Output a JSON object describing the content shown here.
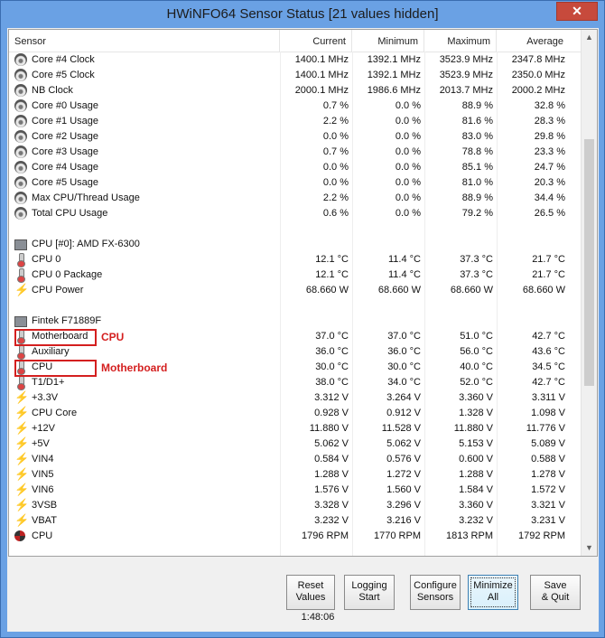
{
  "window": {
    "title": "HWiNFO64 Sensor Status [21 values hidden]",
    "close_glyph": "✕"
  },
  "header": {
    "sensor": "Sensor",
    "current": "Current",
    "minimum": "Minimum",
    "maximum": "Maximum",
    "average": "Average"
  },
  "rows": [
    {
      "icon": "gauge",
      "name": "Core #4 Clock",
      "cur": "1400.1 MHz",
      "min": "1392.1 MHz",
      "max": "3523.9 MHz",
      "avg": "2347.8 MHz"
    },
    {
      "icon": "gauge",
      "name": "Core #5 Clock",
      "cur": "1400.1 MHz",
      "min": "1392.1 MHz",
      "max": "3523.9 MHz",
      "avg": "2350.0 MHz"
    },
    {
      "icon": "gauge",
      "name": "NB Clock",
      "cur": "2000.1 MHz",
      "min": "1986.6 MHz",
      "max": "2013.7 MHz",
      "avg": "2000.2 MHz"
    },
    {
      "icon": "gauge",
      "name": "Core #0 Usage",
      "cur": "0.7 %",
      "min": "0.0 %",
      "max": "88.9 %",
      "avg": "32.8 %"
    },
    {
      "icon": "gauge",
      "name": "Core #1 Usage",
      "cur": "2.2 %",
      "min": "0.0 %",
      "max": "81.6 %",
      "avg": "28.3 %"
    },
    {
      "icon": "gauge",
      "name": "Core #2 Usage",
      "cur": "0.0 %",
      "min": "0.0 %",
      "max": "83.0 %",
      "avg": "29.8 %"
    },
    {
      "icon": "gauge",
      "name": "Core #3 Usage",
      "cur": "0.7 %",
      "min": "0.0 %",
      "max": "78.8 %",
      "avg": "23.3 %"
    },
    {
      "icon": "gauge",
      "name": "Core #4 Usage",
      "cur": "0.0 %",
      "min": "0.0 %",
      "max": "85.1 %",
      "avg": "24.7 %"
    },
    {
      "icon": "gauge",
      "name": "Core #5 Usage",
      "cur": "0.0 %",
      "min": "0.0 %",
      "max": "81.0 %",
      "avg": "20.3 %"
    },
    {
      "icon": "gauge",
      "name": "Max CPU/Thread Usage",
      "cur": "2.2 %",
      "min": "0.0 %",
      "max": "88.9 %",
      "avg": "34.4 %"
    },
    {
      "icon": "gauge",
      "name": "Total CPU Usage",
      "cur": "0.6 %",
      "min": "0.0 %",
      "max": "79.2 %",
      "avg": "26.5 %"
    },
    {
      "icon": "",
      "name": "",
      "cur": "",
      "min": "",
      "max": "",
      "avg": ""
    },
    {
      "icon": "chip",
      "name": "CPU [#0]: AMD FX-6300",
      "cur": "",
      "min": "",
      "max": "",
      "avg": ""
    },
    {
      "icon": "thermo",
      "name": "CPU 0",
      "cur": "12.1 °C",
      "min": "11.4 °C",
      "max": "37.3 °C",
      "avg": "21.7 °C"
    },
    {
      "icon": "thermo",
      "name": "CPU 0 Package",
      "cur": "12.1 °C",
      "min": "11.4 °C",
      "max": "37.3 °C",
      "avg": "21.7 °C"
    },
    {
      "icon": "bolt",
      "name": "CPU Power",
      "cur": "68.660 W",
      "min": "68.660 W",
      "max": "68.660 W",
      "avg": "68.660 W"
    },
    {
      "icon": "",
      "name": "",
      "cur": "",
      "min": "",
      "max": "",
      "avg": ""
    },
    {
      "icon": "chip",
      "name": "Fintek F71889F",
      "cur": "",
      "min": "",
      "max": "",
      "avg": ""
    },
    {
      "icon": "thermo",
      "name": "Motherboard",
      "cur": "37.0 °C",
      "min": "37.0 °C",
      "max": "51.0 °C",
      "avg": "42.7 °C"
    },
    {
      "icon": "thermo",
      "name": "Auxiliary",
      "cur": "36.0 °C",
      "min": "36.0 °C",
      "max": "56.0 °C",
      "avg": "43.6 °C"
    },
    {
      "icon": "thermo",
      "name": "CPU",
      "cur": "30.0 °C",
      "min": "30.0 °C",
      "max": "40.0 °C",
      "avg": "34.5 °C"
    },
    {
      "icon": "thermo",
      "name": "T1/D1+",
      "cur": "38.0 °C",
      "min": "34.0 °C",
      "max": "52.0 °C",
      "avg": "42.7 °C"
    },
    {
      "icon": "bolt",
      "name": "+3.3V",
      "cur": "3.312 V",
      "min": "3.264 V",
      "max": "3.360 V",
      "avg": "3.311 V"
    },
    {
      "icon": "bolt",
      "name": "CPU Core",
      "cur": "0.928 V",
      "min": "0.912 V",
      "max": "1.328 V",
      "avg": "1.098 V"
    },
    {
      "icon": "bolt",
      "name": "+12V",
      "cur": "11.880 V",
      "min": "11.528 V",
      "max": "11.880 V",
      "avg": "11.776 V"
    },
    {
      "icon": "bolt",
      "name": "+5V",
      "cur": "5.062 V",
      "min": "5.062 V",
      "max": "5.153 V",
      "avg": "5.089 V"
    },
    {
      "icon": "bolt",
      "name": "VIN4",
      "cur": "0.584 V",
      "min": "0.576 V",
      "max": "0.600 V",
      "avg": "0.588 V"
    },
    {
      "icon": "bolt",
      "name": "VIN5",
      "cur": "1.288 V",
      "min": "1.272 V",
      "max": "1.288 V",
      "avg": "1.278 V"
    },
    {
      "icon": "bolt",
      "name": "VIN6",
      "cur": "1.576 V",
      "min": "1.560 V",
      "max": "1.584 V",
      "avg": "1.572 V"
    },
    {
      "icon": "bolt",
      "name": "3VSB",
      "cur": "3.328 V",
      "min": "3.296 V",
      "max": "3.360 V",
      "avg": "3.321 V"
    },
    {
      "icon": "bolt",
      "name": "VBAT",
      "cur": "3.232 V",
      "min": "3.216 V",
      "max": "3.232 V",
      "avg": "3.231 V"
    },
    {
      "icon": "fan",
      "name": "CPU",
      "cur": "1796 RPM",
      "min": "1770 RPM",
      "max": "1813 RPM",
      "avg": "1792 RPM"
    }
  ],
  "annotations": {
    "a1": "CPU",
    "a2": "Motherboard"
  },
  "buttons": {
    "reset": [
      "Reset",
      "Values"
    ],
    "logging": [
      "Logging",
      "Start"
    ],
    "configure": [
      "Configure",
      "Sensors"
    ],
    "minimize": [
      "Minimize",
      "All"
    ],
    "save": [
      "Save",
      "& Quit"
    ]
  },
  "timer": "1:48:06",
  "scroll": {
    "up": "▲",
    "down": "▼"
  }
}
